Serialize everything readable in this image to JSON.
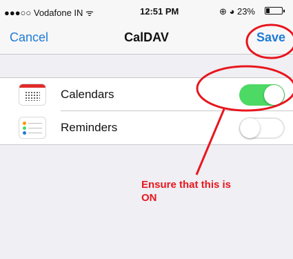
{
  "status_bar": {
    "carrier": "●●●○○ Vodafone IN ᯤ",
    "time": "12:51 PM",
    "right": "⊕ ◕ 23%",
    "battery_level": 0.23
  },
  "nav": {
    "cancel": "Cancel",
    "title": "CalDAV",
    "save": "Save"
  },
  "rows": [
    {
      "label": "Calendars",
      "icon": "calendar-icon",
      "toggle_on": true
    },
    {
      "label": "Reminders",
      "icon": "reminders-icon",
      "toggle_on": false
    }
  ],
  "annotation": {
    "text_line1": "Ensure that this is",
    "text_line2": "ON",
    "color": "#e8161d"
  },
  "colors": {
    "accent": "#1e7ad6",
    "toggle_on": "#4cd964",
    "background": "#efeff4"
  }
}
